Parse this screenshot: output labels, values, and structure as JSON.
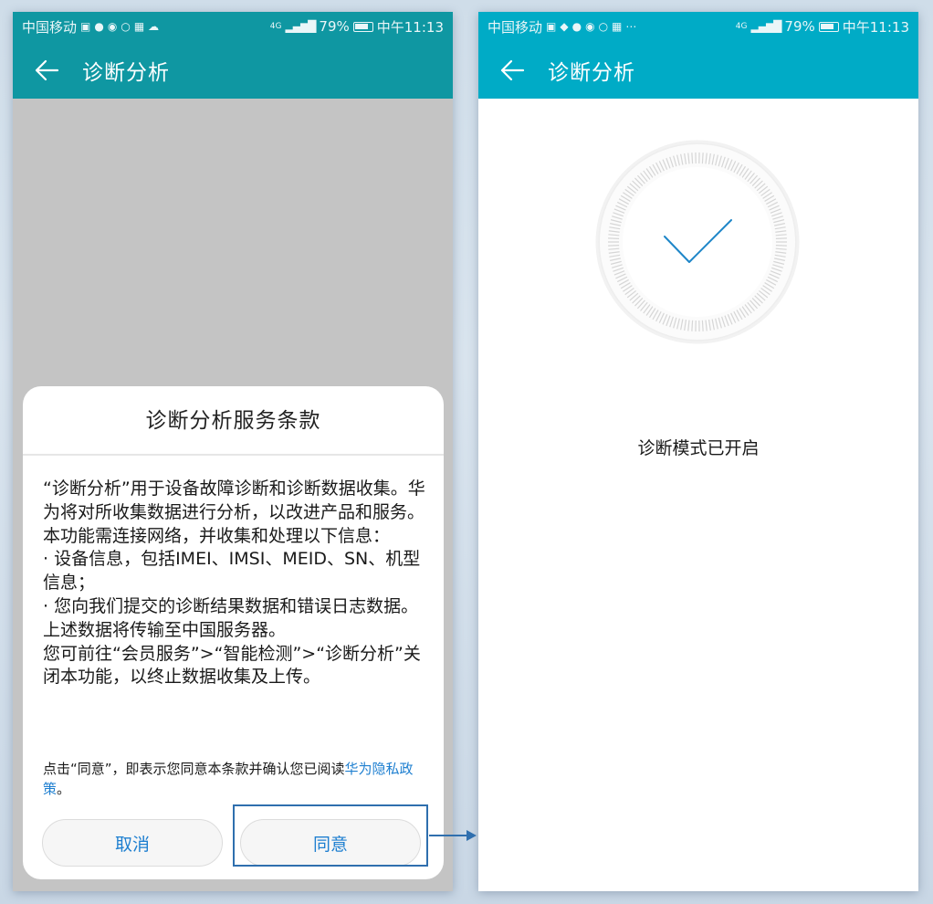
{
  "left_screen": {
    "status_bar": {
      "carrier": "中国移动",
      "network": "4G",
      "battery": "79%",
      "time": "中午11:13"
    },
    "app_bar": {
      "title": "诊断分析"
    },
    "dialog": {
      "title": "诊断分析服务条款",
      "body": [
        "“诊断分析”用于设备故障诊断和诊断数据收集。华为将对所收集数据进行分析，以改进产品和服务。本功能需连接网络，并收集和处理以下信息：",
        "· 设备信息，包括IMEI、IMSI、MEID、SN、机型信息；",
        "· 您向我们提交的诊断结果数据和错误日志数据。",
        "上述数据将传输至中国服务器。",
        "您可前往“会员服务”>“智能检测”>“诊断分析”关闭本功能，以终止数据收集及上传。"
      ],
      "note_prefix": "点击“同意”，即表示您同意本条款并确认您已阅读",
      "note_link": "华为隐私政策",
      "note_suffix": "。",
      "cancel_label": "取消",
      "agree_label": "同意"
    }
  },
  "right_screen": {
    "status_bar": {
      "carrier": "中国移动",
      "network": "4G",
      "battery": "79%",
      "time": "中午11:13"
    },
    "app_bar": {
      "title": "诊断分析"
    },
    "status_message": "诊断模式已开启"
  },
  "colors": {
    "left_appbar": "#0f97a2",
    "right_appbar": "#00abc6",
    "link": "#1e7fd0",
    "checkmark": "#1e86c8",
    "highlight": "#2f6fae"
  }
}
